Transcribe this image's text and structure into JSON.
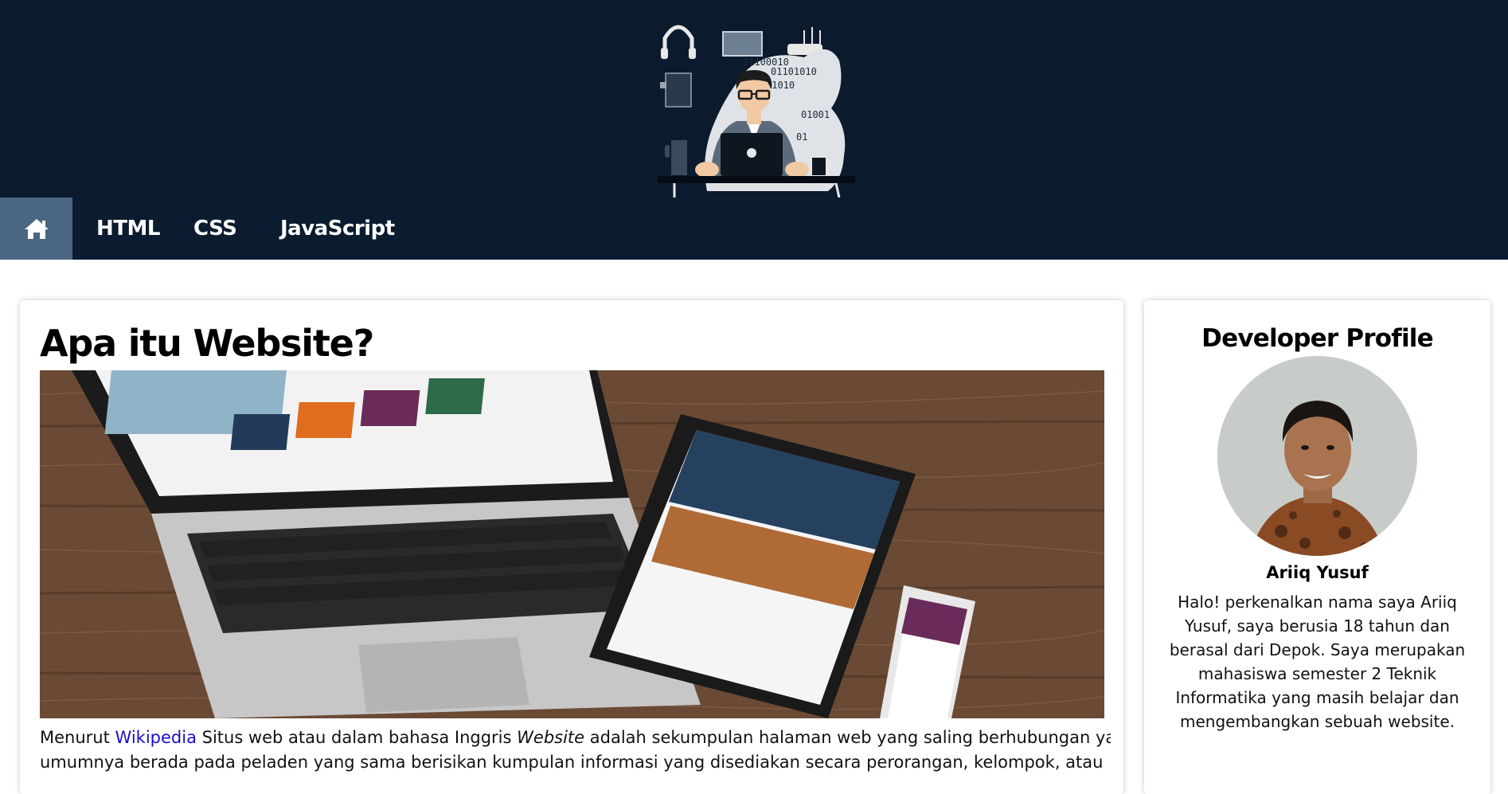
{
  "colors": {
    "header_bg": "#0b1a2c",
    "nav_bg": "#0b1c30",
    "nav_active_bg": "#4b6682",
    "link": "#1a0dcc"
  },
  "header": {
    "illustration": "developer-at-laptop-illustration",
    "binary_lines": [
      "01100010",
      "01101010",
      "01010",
      "01001",
      "01"
    ]
  },
  "nav": {
    "home_icon": "home-icon",
    "items": [
      {
        "label": "HTML"
      },
      {
        "label": "CSS"
      },
      {
        "label": "JavaScript"
      }
    ]
  },
  "article": {
    "title": "Apa itu Website?",
    "image": "laptop-tablet-phone-photo",
    "paragraph": {
      "line1_prefix": "Menurut ",
      "link_text": "Wikipedia",
      "line1_mid": " Situs web atau dalam bahasa Inggris ",
      "emphasis": "Website",
      "line1_suffix": " adalah sekumpulan halaman web yang saling berhubungan yang",
      "line2": "umumnya berada pada peladen yang sama berisikan kumpulan informasi yang disediakan secara perorangan, kelompok, atau"
    }
  },
  "sidebar": {
    "title": "Developer Profile",
    "avatar": "developer-avatar-photo",
    "name": "Ariiq Yusuf",
    "bio": "Halo! perkenalkan nama saya Ariiq Yusuf, saya berusia 18 tahun dan berasal dari Depok. Saya merupakan mahasiswa semester 2 Teknik Informatika yang masih belajar dan mengembangkan sebuah website."
  }
}
